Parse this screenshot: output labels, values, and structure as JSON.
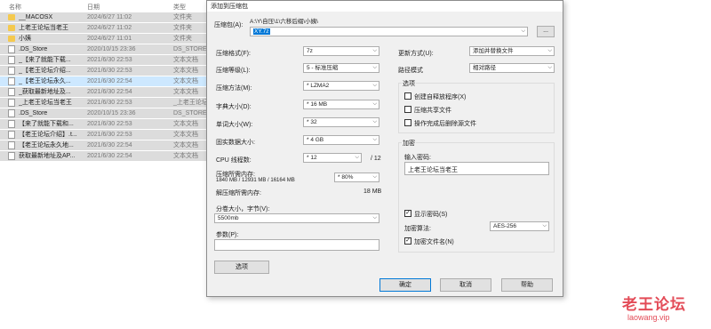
{
  "explorer": {
    "headers": {
      "name": "名称",
      "date": "日期",
      "type": "类型"
    },
    "rows": [
      {
        "icon": "folder",
        "name": "__MACOSX",
        "date": "2024/6/27 11:02",
        "type": "文件夹",
        "selected": false
      },
      {
        "icon": "folder",
        "name": "上老王论坛当老王",
        "date": "2024/6/27 11:02",
        "type": "文件夹",
        "selected": false
      },
      {
        "icon": "folder",
        "name": "小姨",
        "date": "2024/6/27 11:01",
        "type": "文件夹",
        "selected": false
      },
      {
        "icon": "file",
        "name": ".DS_Store",
        "date": "2020/10/15 23:36",
        "type": "DS_STORE",
        "selected": false
      },
      {
        "icon": "file",
        "name": "_【来了就能下载...",
        "date": "2021/6/30 22:53",
        "type": "文本文档",
        "selected": false
      },
      {
        "icon": "file",
        "name": "_【老王论坛介绍...",
        "date": "2021/6/30 22:53",
        "type": "文本文档",
        "selected": false
      },
      {
        "icon": "file",
        "name": "_【老王论坛永久...",
        "date": "2021/6/30 22:54",
        "type": "文本文档",
        "selected": true
      },
      {
        "icon": "file",
        "name": "_获取最新地址及...",
        "date": "2021/6/30 22:54",
        "type": "文本文档",
        "selected": false
      },
      {
        "icon": "file",
        "name": "_上老王论坛当老王",
        "date": "2021/6/30 22:53",
        "type": "_上老王论坛",
        "selected": false
      },
      {
        "icon": "file",
        "name": ".DS_Store",
        "date": "2020/10/15 23:36",
        "type": "DS_STORE",
        "selected": false
      },
      {
        "icon": "file",
        "name": "【来了就能下载和...",
        "date": "2021/6/30 22:53",
        "type": "文本文档",
        "selected": false
      },
      {
        "icon": "file",
        "name": "【老王论坛介绍】.t...",
        "date": "2021/6/30 22:53",
        "type": "文本文档",
        "selected": false
      },
      {
        "icon": "file",
        "name": "【老王论坛永久地...",
        "date": "2021/6/30 22:54",
        "type": "文本文档",
        "selected": false
      },
      {
        "icon": "file",
        "name": "获取最新地址及AP...",
        "date": "2021/6/30 22:54",
        "type": "文本文档",
        "selected": false
      }
    ]
  },
  "dialog": {
    "title": "添加到压缩包",
    "archive": {
      "label": "压缩包(A):",
      "path": "A:\\Y\\自压\\1\\六移后缀\\小姨\\",
      "value": "XY.7z",
      "browse_label": "..."
    },
    "left": {
      "format": {
        "label": "压缩格式(F):",
        "value": "7z"
      },
      "level": {
        "label": "压缩等级(L):",
        "value": "5 - 标准压缩"
      },
      "method": {
        "label": "压缩方法(M):",
        "value": "* LZMA2"
      },
      "dict": {
        "label": "字典大小(D):",
        "value": "* 16 MB"
      },
      "word": {
        "label": "单词大小(W):",
        "value": "* 32"
      },
      "solid": {
        "label": "固实数据大小:",
        "value": "* 4 GB"
      },
      "threads": {
        "label": "CPU 线程数:",
        "value": "* 12",
        "max": "/ 12"
      },
      "memory": {
        "label": "压缩所需内存:",
        "detail": "1840 MB / 12931 MB / 16164 MB",
        "value": "* 80%"
      },
      "decomp": {
        "label": "解压缩所需内存:",
        "value": "18 MB"
      },
      "split": {
        "label": "分卷大小，字节(V):",
        "value": "5500mb"
      },
      "params": {
        "label": "参数(P):",
        "value": ""
      },
      "options_label": "选项"
    },
    "right": {
      "update": {
        "label": "更新方式(U):",
        "value": "添加并替换文件"
      },
      "path_mode": {
        "label": "路径模式",
        "value": "相对路径"
      },
      "options": {
        "title": "选项",
        "items": [
          {
            "label": "创建自释放程序(X)",
            "checked": false
          },
          {
            "label": "压缩共享文件",
            "checked": false
          },
          {
            "label": "操作完成后删除源文件",
            "checked": false
          }
        ]
      },
      "encrypt": {
        "title": "加密",
        "pwd_label": "输入密码:",
        "pwd_value": "上老王论坛当老王",
        "show_pwd": {
          "label": "显示密码(S)",
          "checked": true
        },
        "algo_label": "加密算法:",
        "algo_value": "AES-256",
        "enc_names": {
          "label": "加密文件名(N)",
          "checked": true
        }
      }
    },
    "buttons": {
      "ok": "确定",
      "cancel": "取消",
      "help": "帮助"
    }
  },
  "watermark": {
    "text": "老王论坛",
    "url": "laowang.vip"
  }
}
